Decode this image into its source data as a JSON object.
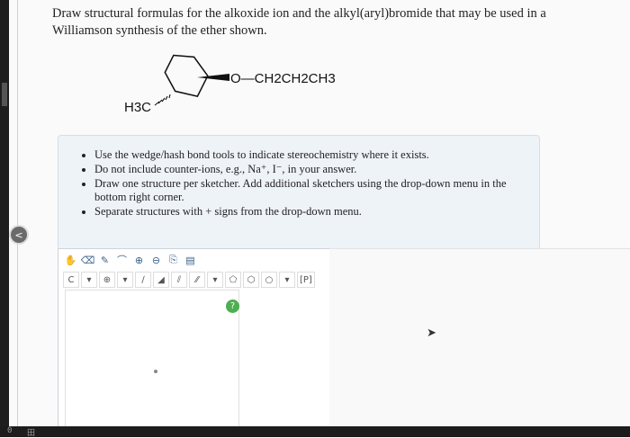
{
  "question": {
    "text": "Draw structural formulas for the alkoxide ion and the alkyl(aryl)bromide that may be used in a Williamson synthesis of the ether shown."
  },
  "molecule": {
    "substituent_right": "O—CH2CH2CH3",
    "substituent_left": "H3C"
  },
  "instructions": {
    "items": [
      "Use the wedge/hash bond tools to indicate stereochemistry where it exists.",
      "Do not include counter-ions, e.g., Na⁺, I⁻, in your answer.",
      "Draw one structure per sketcher. Add additional sketchers using the drop-down menu in the bottom right corner.",
      "Separate structures with + signs from the drop-down menu."
    ]
  },
  "toolbar_row1": [
    "hand-icon",
    "eraser-icon",
    "pencil-icon",
    "lasso-icon",
    "zoom-in-icon",
    "zoom-out-icon",
    "copy-icon",
    "paste-icon"
  ],
  "toolbar_row2": {
    "element": "C",
    "charge": "⊕",
    "ring_label": "[P]"
  },
  "help": {
    "label": "?"
  },
  "collapse": {
    "label": "<"
  },
  "bottom": {
    "left": "0",
    "text": "田"
  }
}
